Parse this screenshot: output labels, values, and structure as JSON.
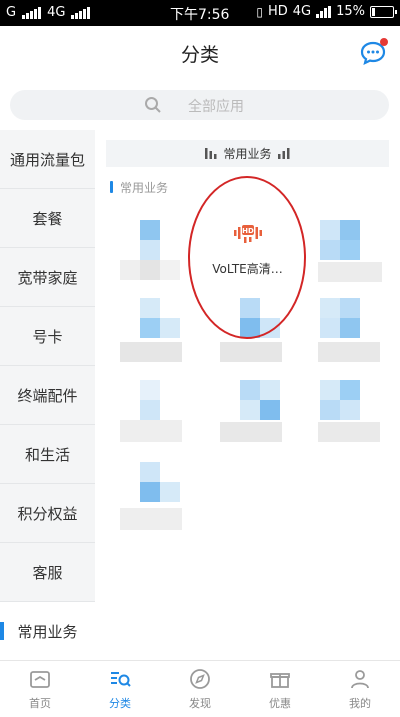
{
  "status_bar": {
    "carrier_left": "G",
    "network_left": "4G",
    "time": "下午7:56",
    "hd_label": "HD",
    "network_right": "4G",
    "battery": "15%",
    "battery_level": 0.15
  },
  "header": {
    "title": "分类",
    "message_icon": "chat-bubble-icon"
  },
  "search": {
    "placeholder": "全部应用"
  },
  "sidebar": {
    "items": [
      {
        "label": "通用流量包"
      },
      {
        "label": "套餐"
      },
      {
        "label": "宽带家庭"
      },
      {
        "label": "号卡"
      },
      {
        "label": "终端配件"
      },
      {
        "label": "和生活"
      },
      {
        "label": "积分权益"
      },
      {
        "label": "客服"
      },
      {
        "label": "常用业务",
        "active": true
      }
    ]
  },
  "content": {
    "section_header": "常用业务",
    "section_label": "常用业务",
    "highlighted_tile": {
      "label": "VoLTE高清…",
      "icon": "volte-hd-icon"
    }
  },
  "bottom_nav": {
    "items": [
      {
        "label": "首页",
        "icon": "home-icon"
      },
      {
        "label": "分类",
        "icon": "category-icon",
        "active": true
      },
      {
        "label": "发现",
        "icon": "compass-icon"
      },
      {
        "label": "优惠",
        "icon": "gift-icon"
      },
      {
        "label": "我的",
        "icon": "user-icon"
      }
    ]
  },
  "colors": {
    "accent": "#1e88e5",
    "annotation_circle": "#d32626",
    "volte_icon": "#e8603c"
  }
}
